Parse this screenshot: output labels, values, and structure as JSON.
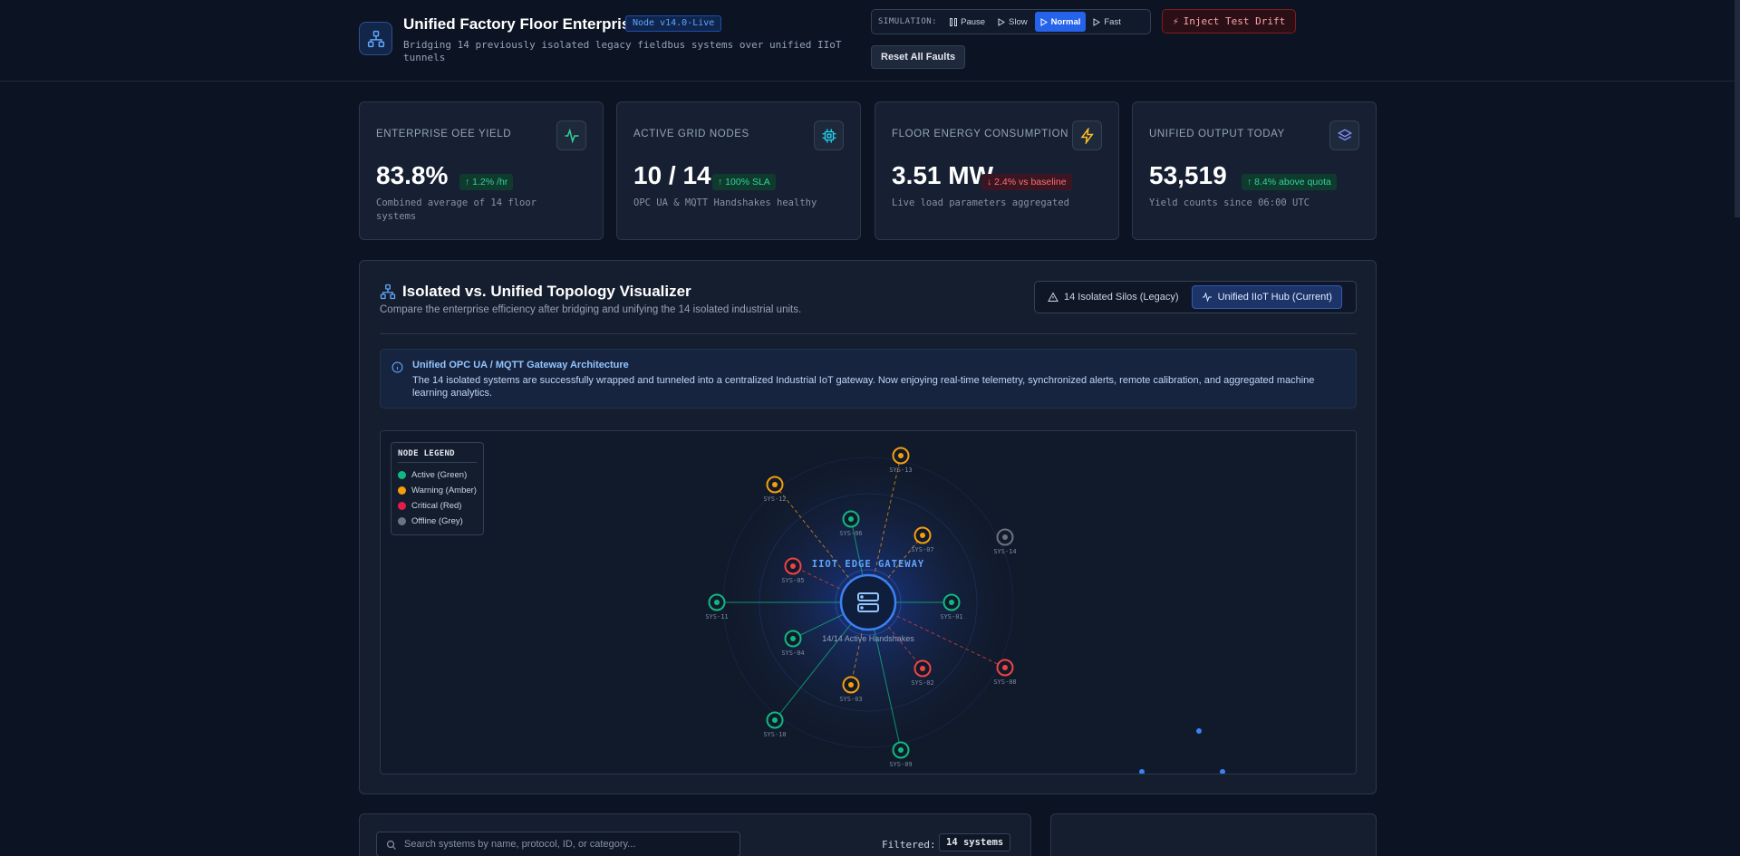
{
  "header": {
    "title": "Unified Factory Floor Enterprise",
    "version": "Node v14.0-Live",
    "subtitle": "Bridging 14 previously isolated legacy fieldbus systems over unified IIoT tunnels",
    "simulation_label": "SIMULATION:",
    "sim_buttons": [
      "Pause",
      "Slow",
      "Normal",
      "Fast"
    ],
    "sim_active": "Normal",
    "inject_label": "Inject Test Drift",
    "reset_label": "Reset All Faults"
  },
  "kpis": [
    {
      "label": "ENTERPRISE OEE YIELD",
      "value": "83.8%",
      "delta": "1.2% /hr",
      "trend": "up",
      "desc": "Combined average of 14 floor systems",
      "icon": "activity-icon"
    },
    {
      "label": "ACTIVE GRID NODES",
      "value": "10 / 14",
      "delta": "100% SLA",
      "trend": "up",
      "desc": "OPC UA & MQTT Handshakes healthy",
      "icon": "cpu-icon"
    },
    {
      "label": "FLOOR ENERGY CONSUMPTION",
      "value": "3.51 MW",
      "delta": "2.4% vs baseline",
      "trend": "down",
      "desc": "Live load parameters aggregated",
      "icon": "lightning-icon"
    },
    {
      "label": "UNIFIED OUTPUT TODAY",
      "value": "53,519",
      "delta": "8.4% above quota",
      "trend": "up",
      "desc": "Yield counts since 06:00 UTC",
      "icon": "layers-icon"
    }
  ],
  "topology": {
    "title": "Isolated vs. Unified Topology Visualizer",
    "subtitle": "Compare the enterprise efficiency after bridging and unifying the 14 isolated industrial units.",
    "toggle_isolated": "14 Isolated Silos (Legacy)",
    "toggle_unified": "Unified IIoT Hub (Current)",
    "info_title": "Unified OPC UA / MQTT Gateway Architecture",
    "info_text": "The 14 isolated systems are successfully wrapped and tunneled into a centralized Industrial IoT gateway. Now enjoying real-time telemetry, synchronized alerts, remote calibration, and aggregated machine learning analytics.",
    "hub_label": "IIOT EDGE GATEWAY",
    "hub_status": "14/14 Active Handshakes",
    "legend_title": "NODE LEGEND",
    "legend": [
      {
        "label": "Active (Green)",
        "color": "#10b981"
      },
      {
        "label": "Warning (Amber)",
        "color": "#f59e0b"
      },
      {
        "label": "Critical (Red)",
        "color": "#e11d48"
      },
      {
        "label": "Offline (Grey)",
        "color": "#6b7280"
      }
    ],
    "colors": {
      "active": "#10b981",
      "warning": "#f59e0b",
      "critical": "#ef4444",
      "offline": "#6b7280",
      "hub": "#3b82f6"
    },
    "nodes": [
      {
        "id": "SYS-01",
        "status": "active"
      },
      {
        "id": "SYS-02",
        "status": "critical"
      },
      {
        "id": "SYS-03",
        "status": "warning"
      },
      {
        "id": "SYS-04",
        "status": "active"
      },
      {
        "id": "SYS-05",
        "status": "critical"
      },
      {
        "id": "SYS-06",
        "status": "active"
      },
      {
        "id": "SYS-07",
        "status": "warning"
      },
      {
        "id": "SYS-08",
        "status": "critical"
      },
      {
        "id": "SYS-09",
        "status": "active"
      },
      {
        "id": "SYS-10",
        "status": "active"
      },
      {
        "id": "SYS-11",
        "status": "active"
      },
      {
        "id": "SYS-12",
        "status": "warning"
      },
      {
        "id": "SYS-13",
        "status": "warning"
      },
      {
        "id": "SYS-14",
        "status": "offline"
      }
    ]
  },
  "systems": {
    "search_placeholder": "Search systems by name, protocol, ID, or category...",
    "filtered_label": "Filtered:",
    "filtered_count": "14 systems"
  }
}
